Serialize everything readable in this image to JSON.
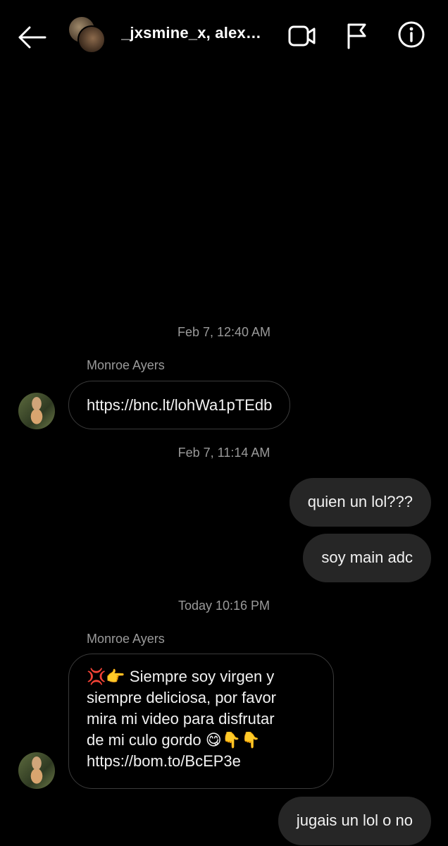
{
  "header": {
    "back_icon": "arrow-left-icon",
    "title": "_jxsmine_x, alex…",
    "video_icon": "video-camera-icon",
    "flag_icon": "flag-icon",
    "info_icon": "info-icon"
  },
  "messages": [
    {
      "type": "timestamp",
      "text": "Feb 7, 12:40 AM"
    },
    {
      "type": "sender",
      "text": "Monroe Ayers"
    },
    {
      "type": "incoming",
      "text": "https://bnc.lt/lohWa1pTEdb"
    },
    {
      "type": "timestamp",
      "text": "Feb 7, 11:14 AM"
    },
    {
      "type": "outgoing",
      "text": "quien un lol???"
    },
    {
      "type": "outgoing",
      "text": "soy main adc"
    },
    {
      "type": "timestamp",
      "text": "Today 10:16 PM"
    },
    {
      "type": "sender",
      "text": "Monroe Ayers"
    },
    {
      "type": "incoming",
      "text": "💢👉 Siempre soy virgen y\nsiempre deliciosa, por favor\nmira mi video para disfrutar\nde mi culo gordo 😋👇👇\nhttps://bom.to/BcEP3e"
    },
    {
      "type": "outgoing",
      "text": "jugais un lol o no"
    }
  ]
}
